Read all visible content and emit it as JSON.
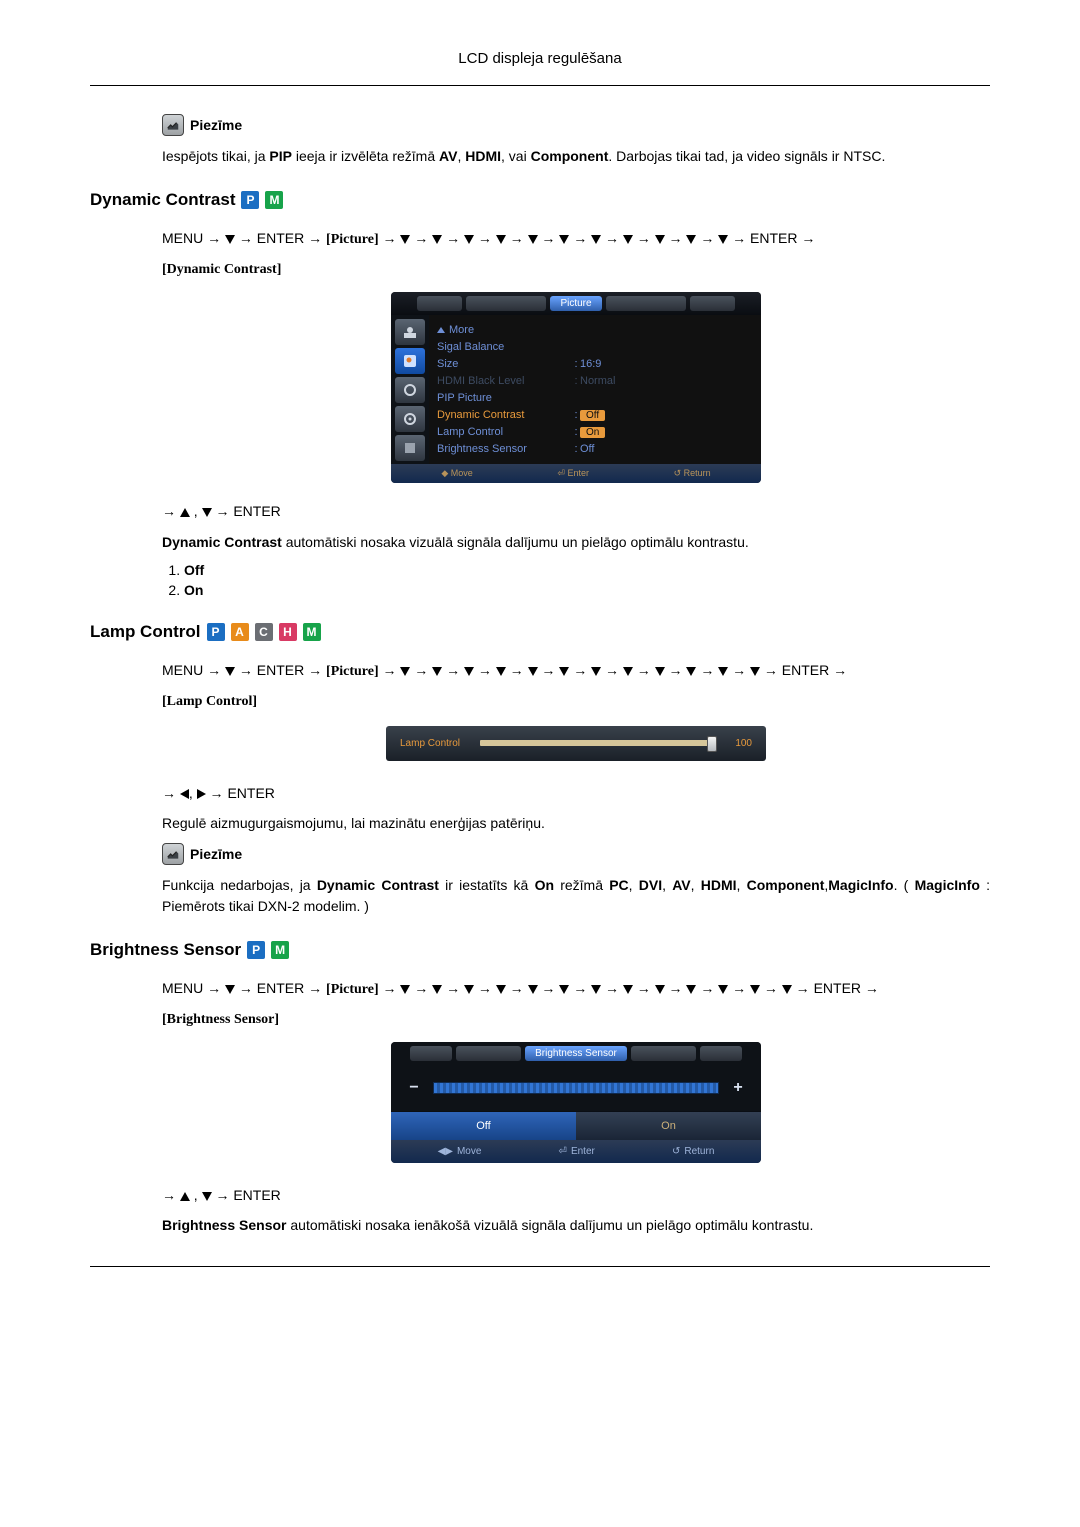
{
  "header": {
    "title": "LCD displeja regulēšana"
  },
  "note_label": "Piezīme",
  "intro_note": {
    "t1": "Iespējots tikai, ja ",
    "pip": "PIP",
    "t2": " ieeja ir izvēlēta režīmā ",
    "av": "AV",
    "c1": ", ",
    "hdmi": "HDMI",
    "c2": ", vai ",
    "comp": "Component",
    "t3": ". Darbojas tikai tad, ja video signāls ir NTSC."
  },
  "badges": {
    "P": "P",
    "M": "M",
    "A": "A",
    "C": "C",
    "H": "H"
  },
  "nav_tokens": {
    "menu": "MENU",
    "enter": "ENTER",
    "picture": "[Picture]"
  },
  "dynamic_contrast": {
    "heading": "Dynamic Contrast",
    "target": "[Dynamic Contrast]",
    "post_nav": " ,  → ENTER",
    "desc_b": "Dynamic Contrast",
    "desc_t": " automātiski nosaka vizuālā signāla dalījumu un pielāgo optimālu kontrastu.",
    "options": [
      "Off",
      "On"
    ]
  },
  "osd_picture": {
    "tab": "Picture",
    "more": "More",
    "rows": [
      {
        "label": "Sigal Balance",
        "val": ""
      },
      {
        "label": "Size",
        "val": "16:9"
      },
      {
        "label": "HDMI Black Level",
        "val": "Normal",
        "dim": true
      },
      {
        "label": "PIP Picture",
        "val": ""
      },
      {
        "label": "Dynamic Contrast",
        "val": "Off",
        "hl": true,
        "box": true
      },
      {
        "label": "Lamp Control",
        "val": "On",
        "box": true
      },
      {
        "label": "Brightness Sensor",
        "val": "Off"
      }
    ],
    "foot": {
      "move": "Move",
      "enter": "Enter",
      "return": "Return"
    }
  },
  "lamp_control": {
    "heading": "Lamp Control",
    "target": "[Lamp Control]",
    "lamp_label": "Lamp Control",
    "lamp_value": "100",
    "post_nav": " ,  → ENTER",
    "desc": "Regulē aizmugurgaismojumu, lai mazinātu enerģijas patēriņu.",
    "note": {
      "t1": "Funkcija nedarbojas, ja ",
      "dc": "Dynamic Contrast",
      "t2": " ir iestatīts kā ",
      "on": "On",
      "t3": " režīmā ",
      "pc": "PC",
      "c": ", ",
      "dvi": "DVI",
      "av": "AV",
      "hdmi": "HDMI",
      "comp": "Component",
      "cma": ",",
      "mi": "MagicInfo",
      "t4": ". ( ",
      "mi2": "MagicInfo",
      "t5": " : Piemērots tikai DXN-2 modelim. )"
    }
  },
  "brightness_sensor": {
    "heading": "Brightness Sensor",
    "target": "[Brightness Sensor]",
    "title": "Brightness Sensor",
    "btn_off": "Off",
    "btn_on": "On",
    "foot": {
      "move": "Move",
      "enter": "Enter",
      "return": "Return"
    },
    "post_nav": " ,  → ENTER",
    "desc_b": "Brightness Sensor",
    "desc_t": " automātiski nosaka ienākošā vizuālā signāla dalījumu un pielāgo optimālu kontrastu."
  }
}
